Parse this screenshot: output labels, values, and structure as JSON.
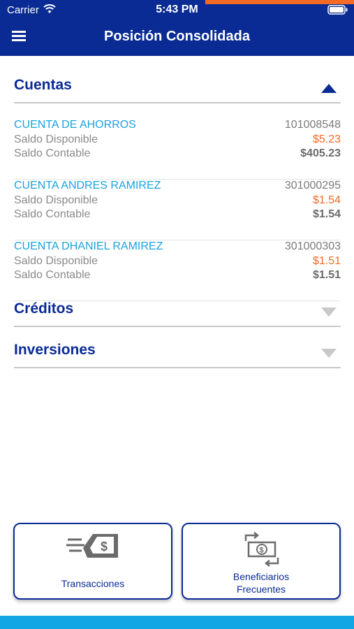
{
  "status_bar": {
    "carrier": "Carrier",
    "time": "5:43 PM"
  },
  "nav": {
    "title": "Posición Consolidada",
    "menu_icon": "hamburger-icon"
  },
  "sections": {
    "cuentas": {
      "title": "Cuentas",
      "expanded": true
    },
    "creditos": {
      "title": "Créditos",
      "expanded": false
    },
    "inversiones": {
      "title": "Inversiones",
      "expanded": false
    }
  },
  "accounts": [
    {
      "name": "CUENTA DE AHORROS",
      "number": "101008548",
      "available_label": "Saldo Disponible",
      "available_value": "$5.23",
      "book_label": "Saldo Contable",
      "book_value": "$405.23"
    },
    {
      "name": "CUENTA ANDRES RAMIREZ",
      "number": "301000295",
      "available_label": "Saldo Disponible",
      "available_value": "$1.54",
      "book_label": "Saldo Contable",
      "book_value": "$1.54"
    },
    {
      "name": "CUENTA DHANIEL RAMIREZ",
      "number": "301000303",
      "available_label": "Saldo Disponible",
      "available_value": "$1.51",
      "book_label": "Saldo Contable",
      "book_value": "$1.51"
    }
  ],
  "actions": {
    "transactions": {
      "label": "Transacciones",
      "icon": "money-transfer-icon"
    },
    "beneficiaries": {
      "label_line1": "Beneficiarios",
      "label_line2": "Frecuentes",
      "icon": "money-exchange-icon"
    }
  },
  "colors": {
    "primary": "#0a2b94",
    "accent_orange": "#f26a25",
    "link_blue": "#1aa3dd",
    "bottom_bar": "#12a6e4"
  }
}
